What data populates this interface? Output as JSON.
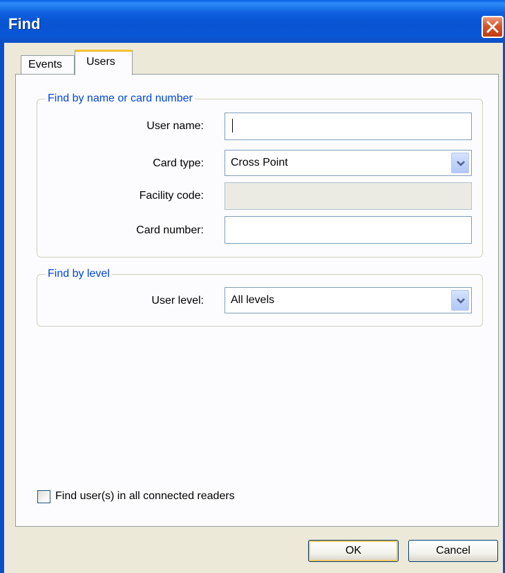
{
  "window": {
    "title": "Find"
  },
  "title_bar": {
    "close_icon": "close-icon"
  },
  "tabs": [
    {
      "label": "Events",
      "active": false
    },
    {
      "label": "Users",
      "active": true
    }
  ],
  "group_name_card": {
    "legend": "Find by name or card number",
    "user_name": {
      "label": "User name:",
      "value": ""
    },
    "card_type": {
      "label": "Card type:",
      "value": "Cross Point"
    },
    "facility_code": {
      "label": "Facility code:",
      "value": "",
      "enabled": false
    },
    "card_number": {
      "label": "Card number:",
      "value": ""
    }
  },
  "group_level": {
    "legend": "Find by level",
    "user_level": {
      "label": "User level:",
      "value": "All levels"
    }
  },
  "options": {
    "all_readers_label": "Find user(s) in all connected readers",
    "all_readers_checked": false
  },
  "buttons": {
    "ok": "OK",
    "cancel": "Cancel"
  },
  "colors": {
    "accent_blue": "#0046d5",
    "titlebar": "#0753d2",
    "tab_highlight": "#f5c036"
  }
}
